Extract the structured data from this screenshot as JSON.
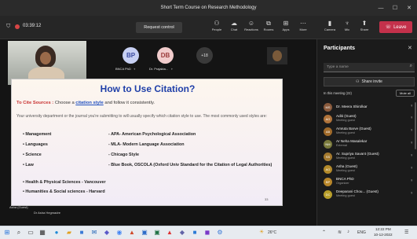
{
  "window": {
    "title": "Short Term Course on Research Methodology",
    "minimize": "—",
    "maximize": "☐",
    "close": "✕"
  },
  "toolbar": {
    "timer": "03:39:12",
    "request_control": "Request control",
    "items": [
      {
        "icon": "people-icon",
        "label": "People"
      },
      {
        "icon": "chat-icon",
        "label": "Chat"
      },
      {
        "icon": "reactions-icon",
        "label": "Reactions"
      },
      {
        "icon": "rooms-icon",
        "label": "Rooms"
      },
      {
        "icon": "apps-icon",
        "label": "Apps"
      },
      {
        "icon": "more-icon",
        "label": "More"
      },
      {
        "icon": "camera-icon",
        "label": "Camera"
      },
      {
        "icon": "mic-icon",
        "label": "Mic"
      },
      {
        "icon": "share-icon",
        "label": "Share"
      }
    ],
    "leave": "Leave"
  },
  "video": {
    "tiles": [
      {
        "initials": "BP",
        "name": "BNCA PhD",
        "color": "#c7d0f3"
      },
      {
        "initials": "DB",
        "name": "Dr. Prajakta...",
        "color": "#f1cccc"
      }
    ],
    "overflow": "+18",
    "self_label": "Asha (Guest)",
    "presenter_label": "Dr Asha Hegmadre"
  },
  "slide": {
    "title": "How to Use Citation?",
    "subtitle_prefix": "To Cite Sources :",
    "subtitle_mid": " Choose a ",
    "subtitle_link": "citation style",
    "subtitle_suffix": " and follow it consistently.",
    "intro": "Your university department or the journal you're submitting to will usually specify which citation style to use. The most commonly used styles are:",
    "items": [
      {
        "field": "Management",
        "style": "- APA- American Psychological Association"
      },
      {
        "field": "Languages",
        "style": "- MLA- Modern Language Association"
      },
      {
        "field": "Science",
        "style": "- Chicago Style"
      },
      {
        "field": "Law",
        "style": "- Blue Book, OSCOLA (Oxford Univ Standard for the Citation of Legal Authorities)"
      }
    ],
    "extra": [
      "Health & Physical Sciences - Vancouver",
      "Humanities & Social sciences - Harvard"
    ],
    "page": "33"
  },
  "participants": {
    "heading": "Participants",
    "search_placeholder": "Type a name",
    "share_invite": "Share invite",
    "section": "In this meeting (22)",
    "mute_all": "Mute all",
    "list": [
      {
        "initials": "MS",
        "name": "Dr. Meera Shirolkar",
        "role": "",
        "color": "#8a5a3c"
      },
      {
        "initials": "AG",
        "name": "Aditi (Guest)",
        "role": "Meeting guest",
        "color": "#b0733a"
      },
      {
        "initials": "AB",
        "name": "Amruta Barve (Guest)",
        "role": "Meeting guest",
        "color": "#a06a2a"
      },
      {
        "initials": "NM",
        "name": "Ar Neha Masalekar",
        "role": "External",
        "color": "#7a7a3c"
      },
      {
        "initials": "SS",
        "name": "Ar. Supriya Savant (Guest)",
        "role": "Meeting guest",
        "color": "#a57a2e"
      },
      {
        "initials": "AG",
        "name": "Asha (Guest)",
        "role": "Meeting guest",
        "color": "#b38a2a"
      },
      {
        "initials": "BP",
        "name": "BNCA PhD",
        "role": "Organizer",
        "color": "#b8862a"
      },
      {
        "initials": "DC",
        "name": "Deeparani Chou... (Guest)",
        "role": "Meeting guest",
        "color": "#b89e2a"
      }
    ]
  },
  "taskbar": {
    "weather": "26°C",
    "lang": "ENG",
    "time": "12:22 PM",
    "date": "10-12-2022"
  },
  "colors": {
    "leave": "#c4314b",
    "slide_title": "#1f3fa8",
    "subtitle": "#c83232",
    "link": "#2050c0"
  }
}
